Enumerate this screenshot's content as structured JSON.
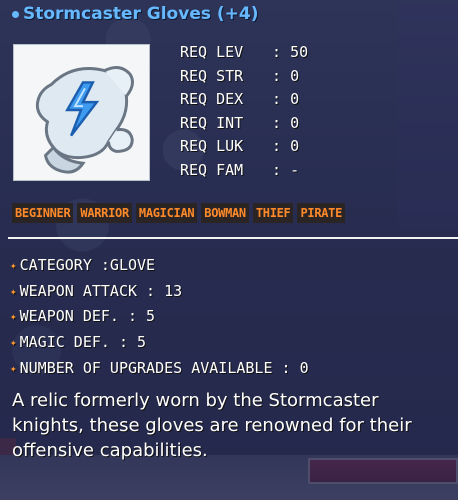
{
  "item": {
    "title": "Stormcaster Gloves (+4)",
    "requirements": [
      {
        "label": "REQ LEV",
        "value": "50"
      },
      {
        "label": "REQ STR",
        "value": "0"
      },
      {
        "label": "REQ DEX",
        "value": "0"
      },
      {
        "label": "REQ INT",
        "value": "0"
      },
      {
        "label": "REQ LUK",
        "value": "0"
      },
      {
        "label": "REQ FAM",
        "value": "-"
      }
    ],
    "jobs": [
      "BEGINNER",
      "WARRIOR",
      "MAGICIAN",
      "BOWMAN",
      "THIEF",
      "PIRATE"
    ],
    "stats": [
      "CATEGORY :GLOVE",
      "WEAPON ATTACK : 13",
      "WEAPON DEF. : 5",
      "MAGIC DEF. : 5",
      "NUMBER OF UPGRADES AVAILABLE : 0"
    ],
    "description": "A relic formerly worn by the Stormcaster knights, these gloves are renowned for their offensive capabilities."
  },
  "icon": "lightning-glove-icon",
  "colors": {
    "title": "#66b8ff",
    "job_text": "#ff8a2a",
    "bullet": "#ff9a32",
    "overlay": "#26284e"
  }
}
